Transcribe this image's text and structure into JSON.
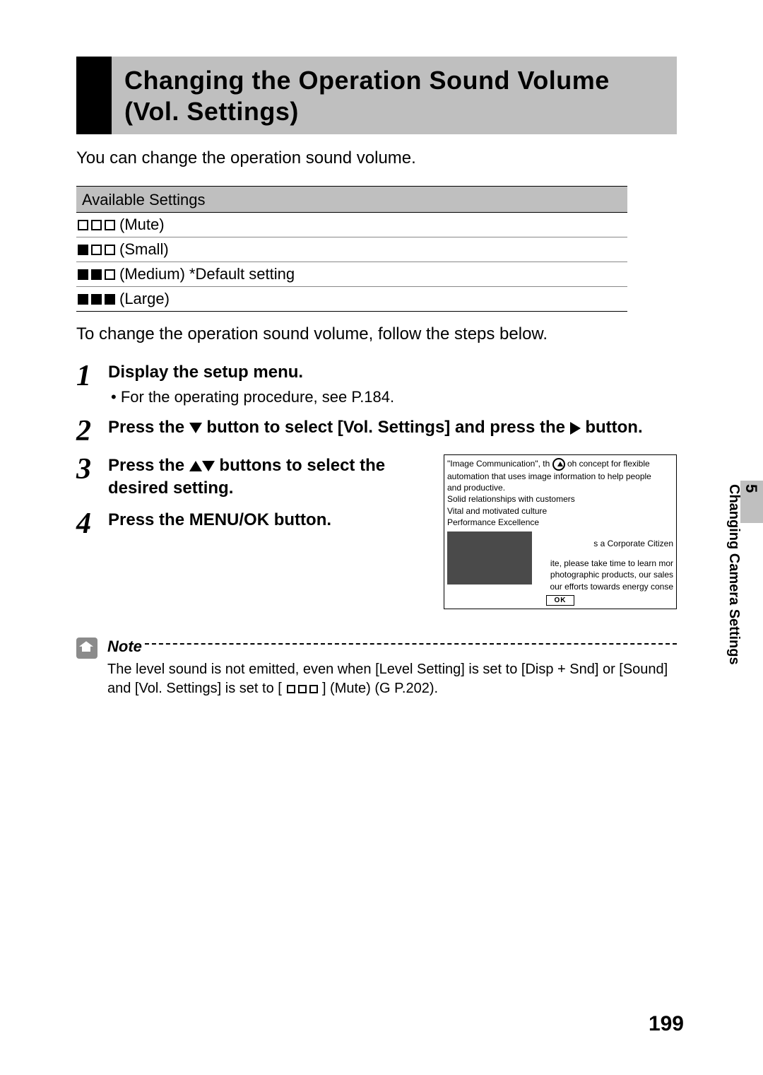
{
  "heading": "Changing the Operation Sound Volume (Vol. Settings)",
  "intro": "You can change the operation sound volume.",
  "settings": {
    "header": "Available Settings",
    "rows": [
      {
        "fill": [
          false,
          false,
          false
        ],
        "label": "(Mute)",
        "default": ""
      },
      {
        "fill": [
          true,
          false,
          false
        ],
        "label": "(Small)",
        "default": ""
      },
      {
        "fill": [
          true,
          true,
          false
        ],
        "label": "(Medium)",
        "default": "*Default setting"
      },
      {
        "fill": [
          true,
          true,
          true
        ],
        "label": "(Large)",
        "default": ""
      }
    ]
  },
  "after_table": "To change the operation sound volume, follow the steps below.",
  "steps": {
    "s1": {
      "num": "1",
      "title": "Display the setup menu.",
      "sub": "For the operating procedure, see P.184."
    },
    "s2": {
      "num": "2",
      "title_a": "Press the ",
      "title_b": " button to select [Vol. Settings] and press the ",
      "title_c": " button."
    },
    "s3": {
      "num": "3",
      "title_a": "Press the ",
      "title_b": " buttons to select the desired setting."
    },
    "s4": {
      "num": "4",
      "title": "Press the MENU/OK button."
    }
  },
  "lcd": {
    "l1a": "\"Image Communication\", th",
    "l1b": "oh concept for flexible",
    "l2": "automation that uses image information to help people",
    "l3": "and productive.",
    "l4": "Solid relationships with customers",
    "l5": "Vital and motivated culture",
    "l6": "Performance Excellence",
    "l7": "s a Corporate Citizen",
    "l8": "ite, please take time to learn mor",
    "l9": "photographic products, our sales",
    "l10": "our efforts towards energy conse",
    "ok": "OK"
  },
  "note": {
    "label": "Note",
    "text_a": "The level sound is not emitted, even when [Level Setting] is set to [Disp + Snd] or [Sound] and [Vol. Settings] is set to [",
    "text_b": "] (Mute) (G    P.202)."
  },
  "side": {
    "num": "5",
    "label": "Changing Camera Settings"
  },
  "page_number": "199"
}
